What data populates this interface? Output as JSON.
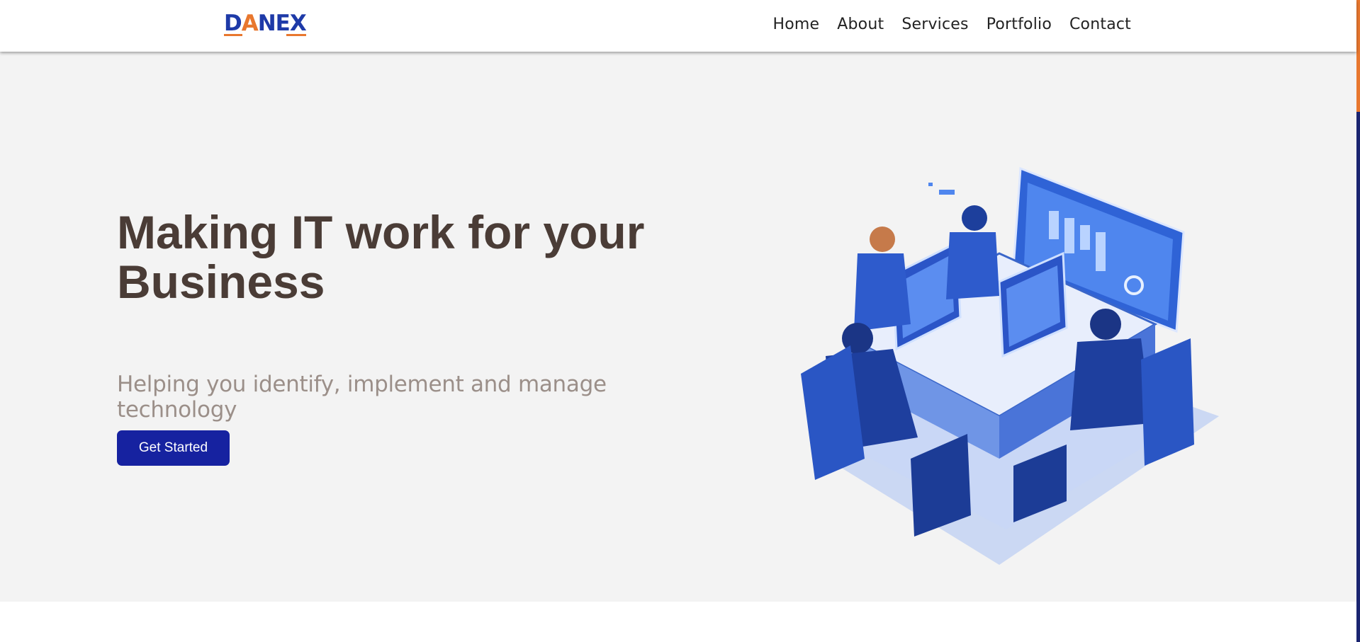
{
  "brand": {
    "logo_text_1": "D",
    "logo_text_a": "A",
    "logo_text_2": "NEX",
    "primary_color": "#1622a0",
    "accent_color": "#e8772e"
  },
  "nav": {
    "items": [
      {
        "label": "Home"
      },
      {
        "label": "About"
      },
      {
        "label": "Services"
      },
      {
        "label": "Portfolio"
      },
      {
        "label": "Contact"
      }
    ]
  },
  "hero": {
    "headline_line1": "Making IT work for your",
    "headline_line2": "Business",
    "subheadline": "Helping you identify, implement and manage technology",
    "cta_label": "Get Started",
    "illustration_icon": "isometric-office-illustration"
  }
}
